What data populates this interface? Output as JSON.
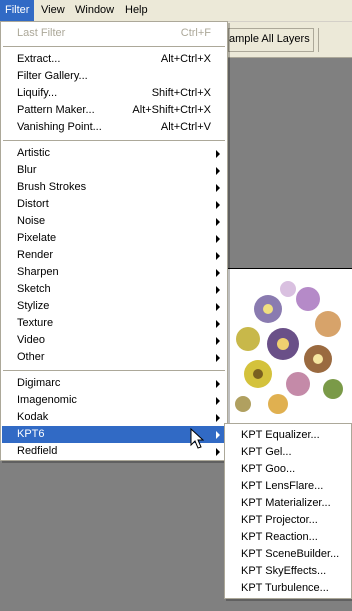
{
  "menubar": {
    "items": [
      {
        "label": "Filter",
        "active": true
      },
      {
        "label": "View",
        "active": false
      },
      {
        "label": "Window",
        "active": false
      },
      {
        "label": "Help",
        "active": false
      }
    ]
  },
  "options_bar": {
    "sample_label": "ample All Layers"
  },
  "filter_menu": {
    "last_filter": {
      "label": "Last Filter",
      "shortcut": "Ctrl+F"
    },
    "group1": [
      {
        "label": "Extract...",
        "shortcut": "Alt+Ctrl+X"
      },
      {
        "label": "Filter Gallery...",
        "shortcut": ""
      },
      {
        "label": "Liquify...",
        "shortcut": "Shift+Ctrl+X"
      },
      {
        "label": "Pattern Maker...",
        "shortcut": "Alt+Shift+Ctrl+X"
      },
      {
        "label": "Vanishing Point...",
        "shortcut": "Alt+Ctrl+V"
      }
    ],
    "group2": [
      "Artistic",
      "Blur",
      "Brush Strokes",
      "Distort",
      "Noise",
      "Pixelate",
      "Render",
      "Sharpen",
      "Sketch",
      "Stylize",
      "Texture",
      "Video",
      "Other"
    ],
    "group3": [
      "Digimarc",
      "Imagenomic",
      "Kodak",
      "KPT6",
      "Redfield"
    ],
    "highlighted": "KPT6"
  },
  "kpt_submenu": {
    "items": [
      "KPT Equalizer...",
      "KPT Gel...",
      "KPT Goo...",
      "KPT LensFlare...",
      "KPT Materializer...",
      "KPT Projector...",
      "KPT Reaction...",
      "KPT SceneBuilder...",
      "KPT SkyEffects...",
      "KPT Turbulence..."
    ]
  },
  "colors": {
    "highlight": "#316ac5",
    "menu_bg": "#ffffff",
    "workspace": "#808080"
  }
}
